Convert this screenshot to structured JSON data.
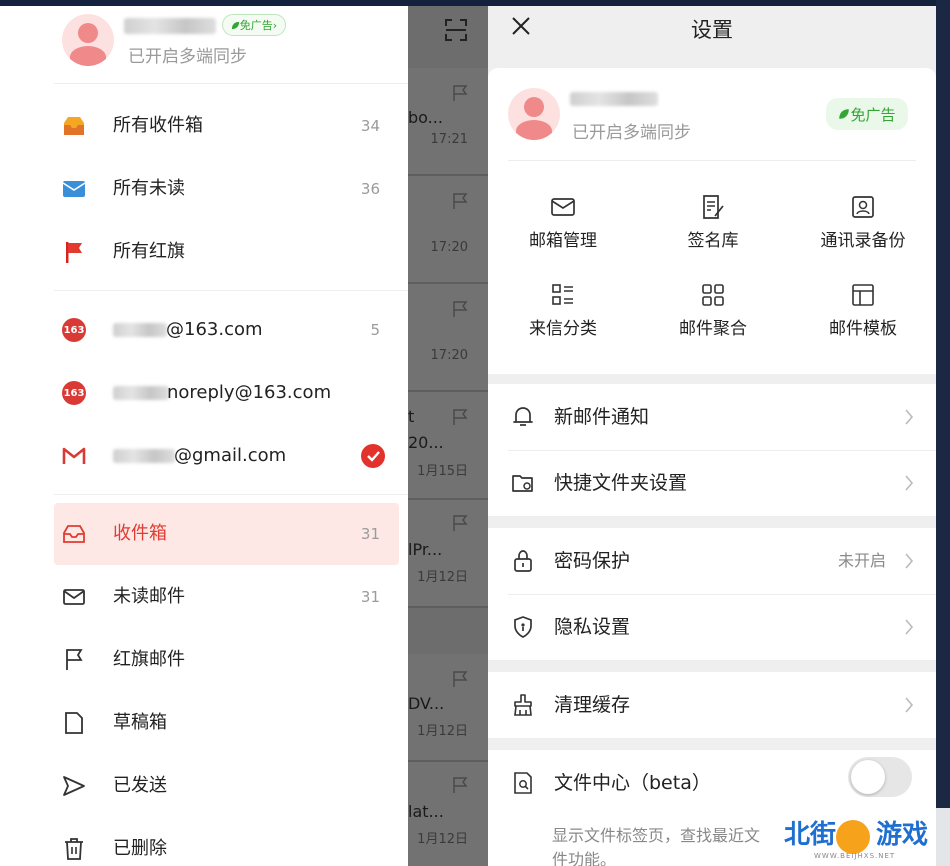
{
  "left_drawer": {
    "account_status": "已开启多端同步",
    "ad_free": "免广告",
    "folders": [
      {
        "label": "所有收件箱",
        "count": "34"
      },
      {
        "label": "所有未读",
        "count": "36"
      },
      {
        "label": "所有红旗",
        "count": ""
      }
    ],
    "accounts": [
      {
        "address": "@163.com",
        "count": "5",
        "badge": "163"
      },
      {
        "address": "noreply@163.com",
        "count": "",
        "badge": "163"
      },
      {
        "address": "@gmail.com",
        "count": "",
        "badge": "M"
      }
    ],
    "mailboxes": [
      {
        "label": "收件箱",
        "count": "31",
        "active": true
      },
      {
        "label": "未读邮件",
        "count": "31"
      },
      {
        "label": "红旗邮件",
        "count": ""
      },
      {
        "label": "草稿箱",
        "count": ""
      },
      {
        "label": "已发送",
        "count": ""
      },
      {
        "label": "已删除",
        "count": ""
      }
    ]
  },
  "mail_list": {
    "items": [
      {
        "snippet": "bo...",
        "time": "17:21"
      },
      {
        "snippet": "",
        "time": "17:20"
      },
      {
        "snippet": "",
        "time": "17:20"
      },
      {
        "snippet": "t\n20...",
        "time": "1月15日"
      },
      {
        "snippet": "lPr...",
        "time": "1月12日"
      },
      {
        "snippet": "DV...",
        "time": "1月12日"
      },
      {
        "snippet": "lat...",
        "time": "1月12日"
      }
    ]
  },
  "settings": {
    "title": "设置",
    "profile_status": "已开启多端同步",
    "ad_free": "免广告",
    "grid": [
      {
        "label": "邮箱管理",
        "icon": "mail-icon"
      },
      {
        "label": "签名库",
        "icon": "signature-icon"
      },
      {
        "label": "通讯录备份",
        "icon": "contact-icon"
      },
      {
        "label": "来信分类",
        "icon": "category-icon"
      },
      {
        "label": "邮件聚合",
        "icon": "aggregate-icon"
      },
      {
        "label": "邮件模板",
        "icon": "template-icon"
      }
    ],
    "rows": {
      "new_mail": "新邮件通知",
      "quick_folder": "快捷文件夹设置",
      "password": "密码保护",
      "password_value": "未开启",
      "privacy": "隐私设置",
      "cache": "清理缓存",
      "file_center": "文件中心（beta）",
      "file_center_desc": "显示文件标签页，查找最近文件功能。"
    }
  },
  "watermark": {
    "text1": "北街",
    "text2": "游戏",
    "url": "WWW.BEIJHXS.NET"
  },
  "colors": {
    "accent": "#e03c31",
    "green": "#33a533"
  }
}
